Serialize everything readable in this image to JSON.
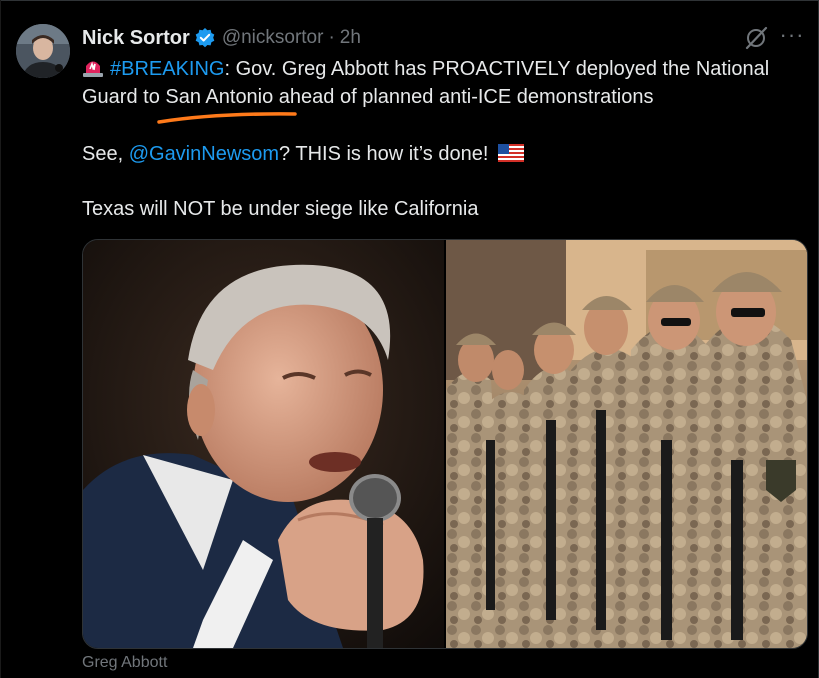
{
  "tweet": {
    "author_name": "Nick Sortor",
    "handle": "@nicksortor",
    "separator": "·",
    "time": "2h",
    "more_label": "···",
    "line1_hashtag": "#BREAKING",
    "line1_rest": ": Gov. Greg Abbott has PROACTIVELY deployed the National",
    "line2": "Guard to San Antonio ahead of planned anti-ICE demonstrations",
    "line3_prefix": "See, ",
    "line3_mention": "@GavinNewsom",
    "line3_suffix": "? THIS is how it’s done!",
    "line4": "Texas will NOT be under siege like California"
  },
  "media": {
    "caption": "Greg Abbott",
    "left_image": "portrait-speaking-into-microphone",
    "right_image": "soldiers-in-camouflage-formation"
  },
  "icons": {
    "verified": "verified-badge-icon",
    "siren": "siren-emoji-icon",
    "flag": "us-flag-emoji-icon",
    "grok": "grok-icon",
    "more": "more-icon"
  },
  "colors": {
    "background": "#000000",
    "text": "#e7e9ea",
    "secondary": "#71767b",
    "link": "#1d9bf0",
    "annotation": "#ff7a1a"
  }
}
